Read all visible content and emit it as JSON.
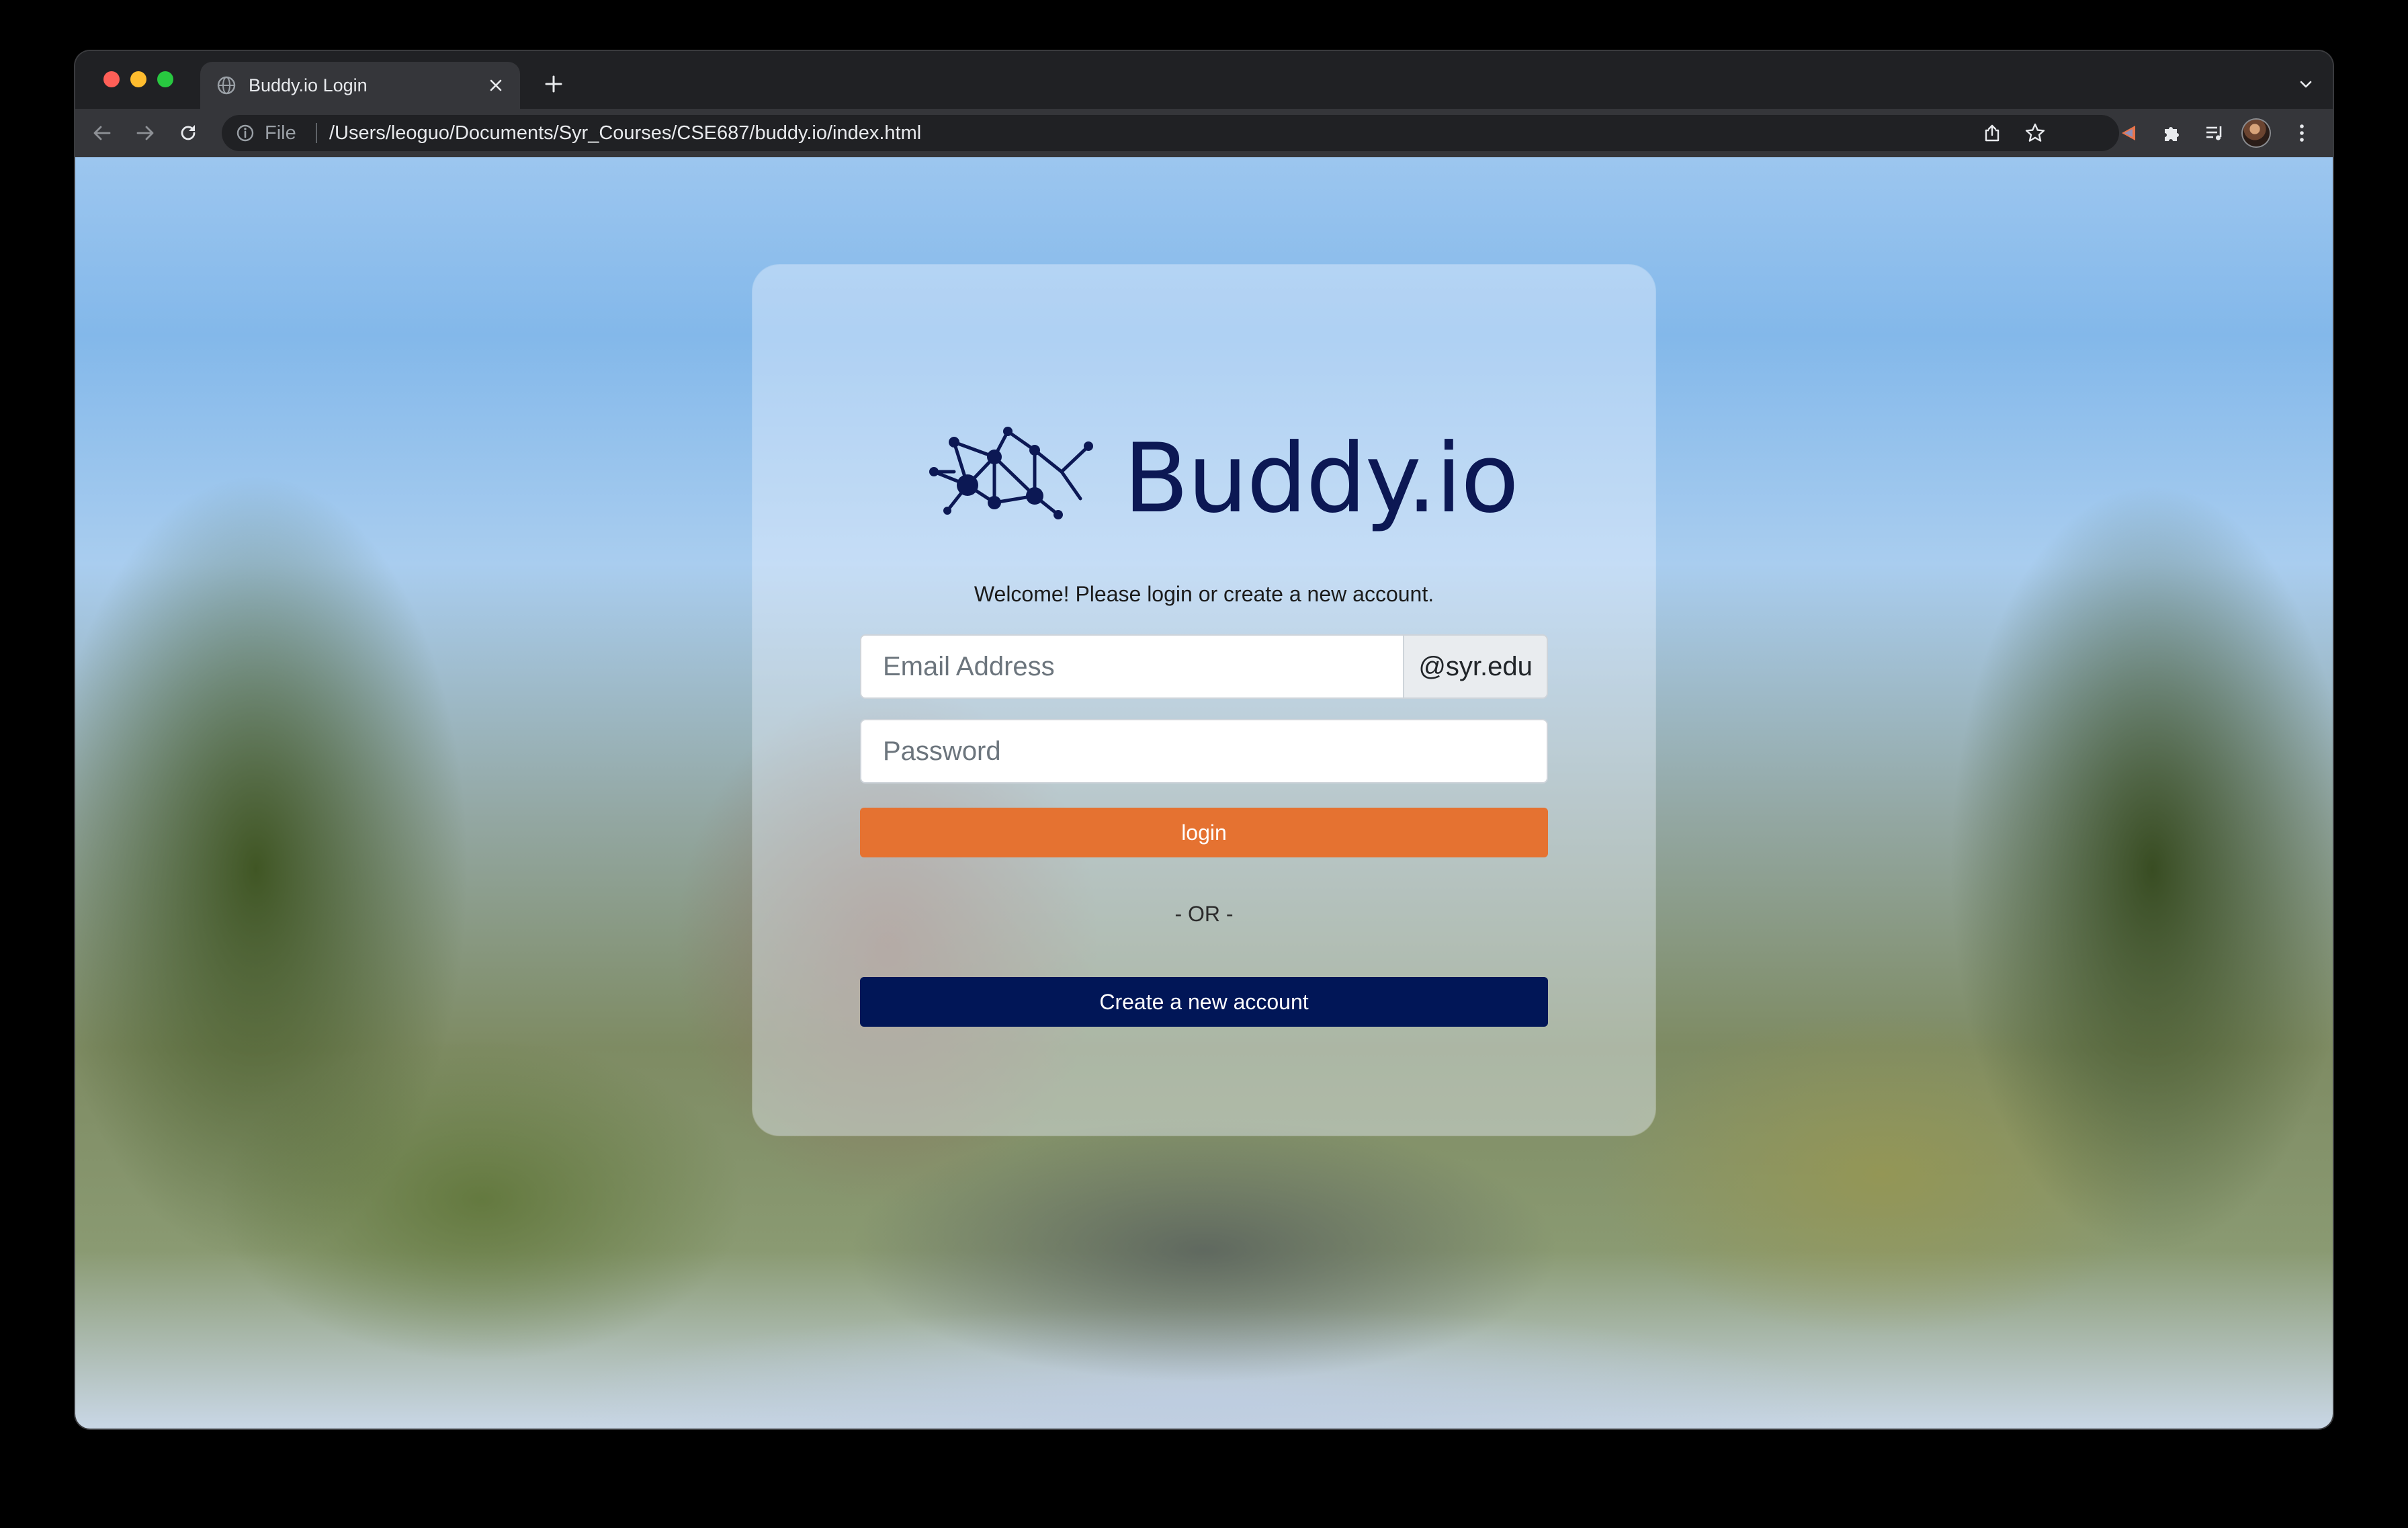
{
  "browser": {
    "tab": {
      "title": "Buddy.io Login",
      "favicon": "globe-icon"
    },
    "new_tab_icon": "plus-icon",
    "address_bar": {
      "scheme_label": "File",
      "url": "/Users/leoguo/Documents/Syr_Courses/CSE687/buddy.io/index.html"
    },
    "toolbar_icons": [
      "back-arrow-icon",
      "forward-arrow-icon",
      "reload-icon",
      "info-icon",
      "share-icon",
      "star-icon",
      "extension-icon",
      "puzzle-icon",
      "media-control-icon",
      "avatar",
      "kebab-menu-icon"
    ]
  },
  "page": {
    "logo_text": "Buddy.io",
    "welcome": "Welcome! Please login or create a new account.",
    "email": {
      "placeholder": "Email Address",
      "value": "",
      "suffix": "@syr.edu"
    },
    "password": {
      "placeholder": "Password",
      "value": ""
    },
    "login_label": "login",
    "or_text": "- OR -",
    "create_label": "Create a new account"
  },
  "colors": {
    "brand_navy": "#011657",
    "login_orange": "#e57231",
    "logo_text": "#0c1854"
  }
}
